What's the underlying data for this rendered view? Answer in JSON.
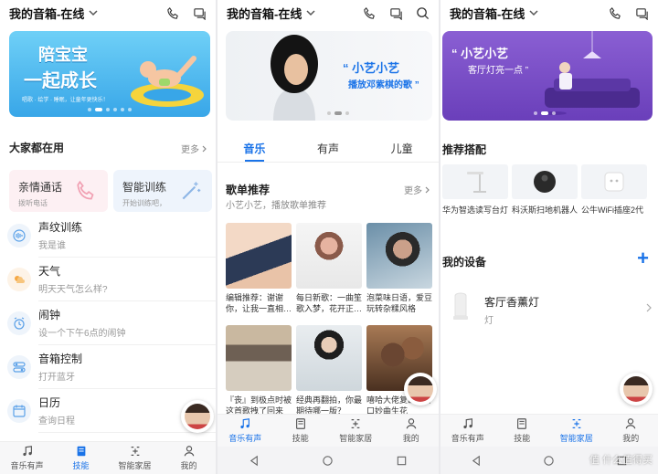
{
  "panel1": {
    "topbar": {
      "title": "我的音箱-在线",
      "icons": [
        "phone-icon",
        "chat-icon"
      ]
    },
    "banner": {
      "line1": "陪宝宝",
      "line2": "一起成长",
      "sub": "唱歌 · 绘学 · 睡眠，让童年更快乐！"
    },
    "section": {
      "title": "大家都在用",
      "more": "更多"
    },
    "cards": [
      {
        "title": "亲情通话",
        "subtitle": "拨听电话",
        "icon": "phone-icon",
        "bg": "#fdf0f3"
      },
      {
        "title": "智能训练",
        "subtitle": "开始训练吧，",
        "icon": "magic-wand-icon",
        "bg": "#eef4fc"
      }
    ],
    "list": [
      {
        "title": "声纹训练",
        "subtitle": "我是谁",
        "icon": "voiceprint-icon"
      },
      {
        "title": "天气",
        "subtitle": "明天天气怎么样?",
        "icon": "weather-icon"
      },
      {
        "title": "闹钟",
        "subtitle": "设一个下午6点的闹钟",
        "icon": "alarm-icon"
      },
      {
        "title": "音箱控制",
        "subtitle": "打开蓝牙",
        "icon": "toggle-icon"
      },
      {
        "title": "日历",
        "subtitle": "查询日程",
        "icon": "calendar-icon"
      }
    ],
    "tabbar": [
      {
        "label": "音乐有声",
        "icon": "music-note-icon",
        "active": false
      },
      {
        "label": "技能",
        "icon": "book-icon",
        "active": true
      },
      {
        "label": "智能家居",
        "icon": "smart-home-icon",
        "active": false
      },
      {
        "label": "我的",
        "icon": "person-icon",
        "active": false
      }
    ]
  },
  "panel2": {
    "topbar": {
      "title": "我的音箱-在线",
      "icons": [
        "phone-icon",
        "chat-icon",
        "search-icon"
      ]
    },
    "banner": {
      "quote": "“ 小艺小艺",
      "line2": "播放邓紫棋的歌 ”"
    },
    "tabs": [
      {
        "label": "音乐",
        "active": true
      },
      {
        "label": "有声",
        "active": false
      },
      {
        "label": "儿童",
        "active": false
      }
    ],
    "section": {
      "title": "歌单推荐",
      "subtitle": "小艺小艺，播放歌单推荐",
      "more": "更多"
    },
    "tiles": [
      {
        "caption": "编辑推荐：谢谢你，让我一直相…"
      },
      {
        "caption": "每日新歌：一曲笙歌入梦，花开正…"
      },
      {
        "caption": "泡菜味日语，爱豆玩转杂糅风格"
      },
      {
        "caption": "『丧』到极点时被这首歌拽了回来"
      },
      {
        "caption": "经典再翻拍，你最期待哪一版？"
      },
      {
        "caption": "嘻哈大佬复出，开口妙曲生花"
      }
    ],
    "tabbar": [
      {
        "label": "音乐有声",
        "icon": "music-note-icon",
        "active": true
      },
      {
        "label": "技能",
        "icon": "book-icon",
        "active": false
      },
      {
        "label": "智能家居",
        "icon": "smart-home-icon",
        "active": false
      },
      {
        "label": "我的",
        "icon": "person-icon",
        "active": false
      }
    ]
  },
  "panel3": {
    "topbar": {
      "title": "我的音箱-在线",
      "icons": [
        "phone-icon",
        "chat-icon"
      ]
    },
    "banner": {
      "quote": "“ 小艺小艺",
      "line2": "客厅灯亮一点 ”"
    },
    "section": {
      "title": "推荐搭配"
    },
    "products": [
      {
        "name": "华为智选读写台灯",
        "icon": "desk-lamp-icon"
      },
      {
        "name": "科沃斯扫地机器人",
        "icon": "robot-vacuum-icon"
      },
      {
        "name": "公牛WiFi插座2代",
        "icon": "smart-plug-icon"
      }
    ],
    "devices": {
      "title": "我的设备",
      "add": "+"
    },
    "device": {
      "name": "客厅香薰灯",
      "type": "灯"
    },
    "tabbar": [
      {
        "label": "音乐有声",
        "icon": "music-note-icon",
        "active": false
      },
      {
        "label": "技能",
        "icon": "book-icon",
        "active": false
      },
      {
        "label": "智能家居",
        "icon": "smart-home-icon",
        "active": true
      },
      {
        "label": "我的",
        "icon": "person-icon",
        "active": false
      }
    ],
    "watermark": "值 什么值得买"
  },
  "colors": {
    "accent": "#1a73e8",
    "banner1": "#4ab0f0",
    "banner3": "#7b51c8"
  }
}
